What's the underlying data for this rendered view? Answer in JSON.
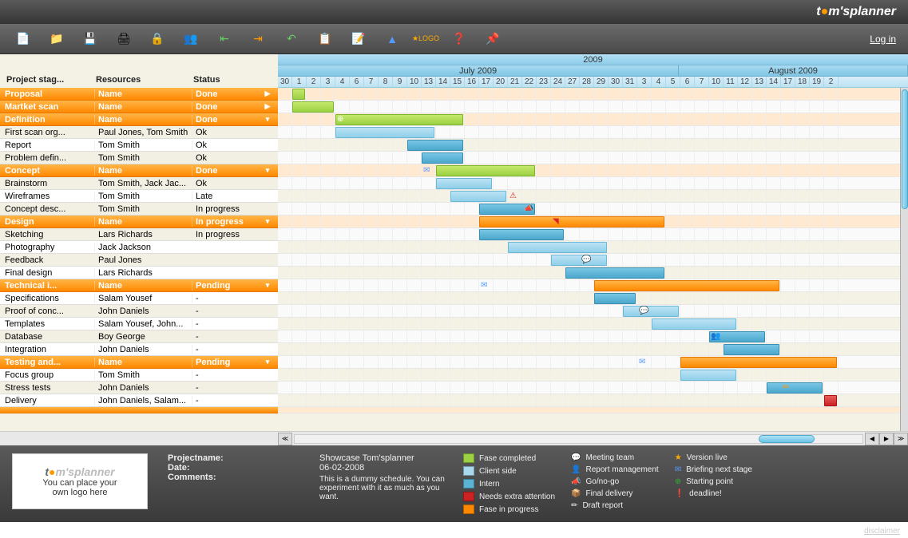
{
  "brand": {
    "prefix": "t",
    "o": "●",
    "suffix": "m'splanner"
  },
  "login": "Log in",
  "cols": {
    "c1": "Project stag...",
    "c2": "Resources",
    "c3": "Status"
  },
  "year": "2009",
  "months": [
    {
      "label": "July 2009",
      "span": 28
    },
    {
      "label": "August 2009",
      "span": 16
    }
  ],
  "days": [
    "30",
    "1",
    "2",
    "3",
    "4",
    "6",
    "7",
    "8",
    "9",
    "10",
    "13",
    "14",
    "15",
    "16",
    "17",
    "20",
    "21",
    "22",
    "23",
    "24",
    "27",
    "28",
    "29",
    "30",
    "31",
    "3",
    "4",
    "5",
    "6",
    "7",
    "10",
    "11",
    "12",
    "13",
    "14",
    "17",
    "18",
    "19",
    "2"
  ],
  "rows": [
    {
      "type": "phase",
      "c1": "Proposal",
      "c2": "Name",
      "c3": "Done",
      "arr": "▶",
      "bars": [
        {
          "start": 1,
          "len": 1,
          "cls": "bar-green"
        }
      ]
    },
    {
      "type": "phase",
      "c1": "Martket scan",
      "c2": "Name",
      "c3": "Done",
      "arr": "▶",
      "bars": [
        {
          "start": 1,
          "len": 3,
          "cls": "bar-green"
        }
      ]
    },
    {
      "type": "phase",
      "c1": "Definition",
      "c2": "Name",
      "c3": "Done",
      "arr": "▾",
      "bars": [
        {
          "start": 4,
          "len": 9,
          "cls": "bar-green"
        }
      ],
      "icos": [
        {
          "pos": 4,
          "c": "⊕",
          "color": "#fff",
          "bg": "#3a3"
        }
      ]
    },
    {
      "type": "task",
      "c1": "First scan org...",
      "c2": "Paul Jones, Tom Smith",
      "c3": "Ok",
      "bars": [
        {
          "start": 4,
          "len": 7,
          "cls": "bar-blue"
        }
      ]
    },
    {
      "type": "task",
      "c1": "Report",
      "c2": "Tom Smith",
      "c3": "Ok",
      "bars": [
        {
          "start": 9,
          "len": 4,
          "cls": "bar-darkblue"
        }
      ]
    },
    {
      "type": "task",
      "c1": "Problem defin...",
      "c2": "Tom Smith",
      "c3": "Ok",
      "bars": [
        {
          "start": 10,
          "len": 3,
          "cls": "bar-darkblue"
        }
      ]
    },
    {
      "type": "phase",
      "c1": "Concept",
      "c2": "Name",
      "c3": "Done",
      "arr": "▾",
      "bars": [
        {
          "start": 11,
          "len": 7,
          "cls": "bar-green"
        }
      ],
      "icos": [
        {
          "pos": 10,
          "c": "✉",
          "color": "#59f"
        }
      ]
    },
    {
      "type": "task",
      "c1": "Brainstorm",
      "c2": "Tom Smith, Jack Jac...",
      "c3": "Ok",
      "bars": [
        {
          "start": 11,
          "len": 4,
          "cls": "bar-blue"
        }
      ]
    },
    {
      "type": "task",
      "c1": "Wireframes",
      "c2": "Tom Smith",
      "c3": "Late",
      "bars": [
        {
          "start": 12,
          "len": 4,
          "cls": "bar-blue"
        }
      ],
      "icos": [
        {
          "pos": 16,
          "c": "⚠",
          "color": "#d22"
        }
      ]
    },
    {
      "type": "task",
      "c1": "Concept desc...",
      "c2": "Tom Smith",
      "c3": "In progress",
      "bars": [
        {
          "start": 14,
          "len": 4,
          "cls": "bar-darkblue"
        }
      ],
      "icos": [
        {
          "pos": 17,
          "c": "📣",
          "color": "#f90"
        }
      ]
    },
    {
      "type": "phase",
      "c1": "Design",
      "c2": "Name",
      "c3": "In progress",
      "arr": "▾",
      "bars": [
        {
          "start": 14,
          "len": 13,
          "cls": "bar-orange"
        }
      ],
      "icos": [
        {
          "pos": 19,
          "c": "◥",
          "color": "#d22"
        }
      ]
    },
    {
      "type": "task",
      "c1": "Sketching",
      "c2": "Lars Richards",
      "c3": "In progress",
      "bars": [
        {
          "start": 14,
          "len": 6,
          "cls": "bar-darkblue"
        }
      ]
    },
    {
      "type": "task",
      "c1": "Photography",
      "c2": "Jack Jackson",
      "c3": "",
      "bars": [
        {
          "start": 16,
          "len": 7,
          "cls": "bar-blue"
        }
      ]
    },
    {
      "type": "task",
      "c1": "Feedback",
      "c2": "Paul Jones",
      "c3": "",
      "bars": [
        {
          "start": 19,
          "len": 4,
          "cls": "bar-blue"
        }
      ],
      "icos": [
        {
          "pos": 21,
          "c": "💬",
          "color": "#59f"
        }
      ]
    },
    {
      "type": "task",
      "c1": "Final design",
      "c2": "Lars Richards",
      "c3": "",
      "bars": [
        {
          "start": 20,
          "len": 7,
          "cls": "bar-darkblue"
        }
      ]
    },
    {
      "type": "phase",
      "c1": "Technical i...",
      "c2": "Name",
      "c3": "Pending",
      "arr": "▾",
      "bars": [
        {
          "start": 22,
          "len": 13,
          "cls": "bar-orange"
        }
      ],
      "icos": [
        {
          "pos": 14,
          "c": "✉",
          "color": "#59f"
        }
      ]
    },
    {
      "type": "task",
      "c1": "Specifications",
      "c2": "Salam Yousef",
      "c3": "-",
      "bars": [
        {
          "start": 22,
          "len": 3,
          "cls": "bar-darkblue"
        }
      ]
    },
    {
      "type": "task",
      "c1": "Proof of conc...",
      "c2": "John Daniels",
      "c3": "-",
      "bars": [
        {
          "start": 24,
          "len": 4,
          "cls": "bar-blue"
        }
      ],
      "icos": [
        {
          "pos": 25,
          "c": "💬",
          "color": "#59f"
        }
      ]
    },
    {
      "type": "task",
      "c1": "Templates",
      "c2": "Salam Yousef, John...",
      "c3": "-",
      "bars": [
        {
          "start": 26,
          "len": 6,
          "cls": "bar-blue"
        }
      ]
    },
    {
      "type": "task",
      "c1": "Database",
      "c2": "Boy George",
      "c3": "-",
      "bars": [
        {
          "start": 30,
          "len": 4,
          "cls": "bar-darkblue"
        }
      ],
      "icos": [
        {
          "pos": 30,
          "c": "👥",
          "color": "#59f"
        }
      ]
    },
    {
      "type": "task",
      "c1": "Integration",
      "c2": "John Daniels",
      "c3": "-",
      "bars": [
        {
          "start": 31,
          "len": 4,
          "cls": "bar-darkblue"
        }
      ]
    },
    {
      "type": "phase",
      "c1": "Testing and...",
      "c2": "Name",
      "c3": "Pending",
      "arr": "▾",
      "bars": [
        {
          "start": 28,
          "len": 11,
          "cls": "bar-orange"
        }
      ],
      "icos": [
        {
          "pos": 25,
          "c": "✉",
          "color": "#59f"
        }
      ]
    },
    {
      "type": "task",
      "c1": "Focus group",
      "c2": "Tom Smith",
      "c3": "-",
      "bars": [
        {
          "start": 28,
          "len": 4,
          "cls": "bar-blue"
        }
      ]
    },
    {
      "type": "task",
      "c1": "Stress tests",
      "c2": "John Daniels",
      "c3": "-",
      "bars": [
        {
          "start": 34,
          "len": 4,
          "cls": "bar-darkblue"
        }
      ],
      "icos": [
        {
          "pos": 35,
          "c": "✏",
          "color": "#f90"
        }
      ]
    },
    {
      "type": "task",
      "c1": "Delivery",
      "c2": "John Daniels, Salam...",
      "c3": "-",
      "bars": [
        {
          "start": 38,
          "len": 1,
          "cls": "bar-red"
        }
      ]
    }
  ],
  "footer": {
    "box": {
      "logo": "t●m'splanner",
      "line1": "You can place your",
      "line2": "own logo here"
    },
    "projectname_label": "Projectname:",
    "projectname": "Showcase Tom'splanner",
    "date_label": "Date:",
    "date": "06-02-2008",
    "comments_label": "Comments:",
    "comments": "This is a dummy schedule. You can experiment with it as much as you want.",
    "legend1": [
      {
        "sw": "sw-green",
        "t": "Fase completed"
      },
      {
        "sw": "sw-lblue",
        "t": "Client side"
      },
      {
        "sw": "sw-dblue",
        "t": "Intern"
      },
      {
        "sw": "sw-red",
        "t": "Needs extra attention"
      },
      {
        "sw": "sw-orange",
        "t": "Fase in progress"
      }
    ],
    "legend2": [
      {
        "ico": "💬",
        "t": "Meeting team"
      },
      {
        "ico": "👤",
        "t": "Report management"
      },
      {
        "ico": "📣",
        "t": "Go/no-go"
      },
      {
        "ico": "📦",
        "t": "Final delivery"
      },
      {
        "ico": "✏",
        "t": "Draft report"
      }
    ],
    "legend3": [
      {
        "ico": "★",
        "t": "Version live",
        "color": "#fa0"
      },
      {
        "ico": "✉",
        "t": "Briefing next stage",
        "color": "#59f"
      },
      {
        "ico": "⊕",
        "t": "Starting point",
        "color": "#3a3"
      },
      {
        "ico": "❗",
        "t": "deadline!",
        "color": "#d22"
      }
    ]
  },
  "disclaimer": "disclaimer"
}
